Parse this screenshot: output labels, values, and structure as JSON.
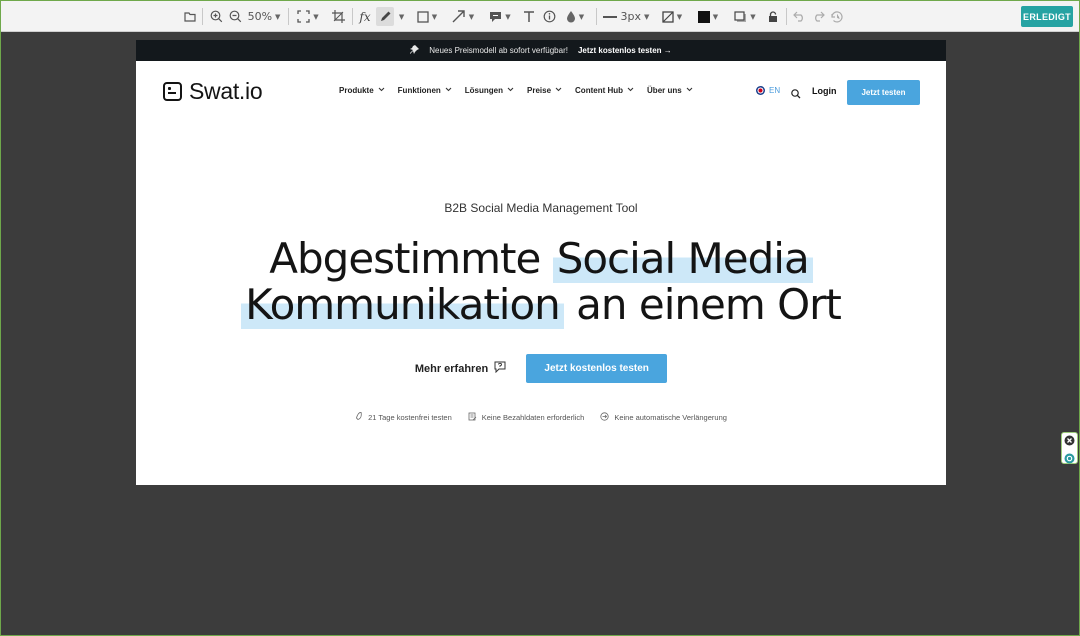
{
  "toolbar": {
    "zoom_value": "50%",
    "stroke_width": "3px",
    "fx_label": "fx",
    "done_label": "ERLEDIGT",
    "tools": [
      "folder-icon",
      "zoom-in-icon",
      "zoom-out-icon",
      "fit-icon",
      "crop-icon",
      "formula-icon",
      "pen-icon",
      "rectangle-icon",
      "arrow-icon",
      "comment-icon",
      "text-icon",
      "info-icon",
      "blur-icon",
      "line-width-icon",
      "fill-icon",
      "color-swatch",
      "shadow-icon",
      "lock-icon",
      "undo-icon",
      "redo-icon",
      "history-icon"
    ],
    "color_value": "#111111"
  },
  "page": {
    "banner": {
      "icon": "pin-icon",
      "text": "Neues Preismodell ab sofort verfügbar!",
      "link": "Jetzt kostenlos testen",
      "arrow": "→"
    },
    "logo_text": "Swat.io",
    "menu": [
      "Produkte",
      "Funktionen",
      "Lösungen",
      "Preise",
      "Content Hub",
      "Über uns"
    ],
    "lang": "EN",
    "login": "Login",
    "cta_top": "Jetzt testen",
    "subtitle": "B2B Social Media Management Tool",
    "headline": {
      "part1": "Abgestimmte",
      "highlight1": "Social Media",
      "highlight2": "Kommunikation",
      "part2": "an einem Ort"
    },
    "more_label": "Mehr erfahren",
    "cta_main": "Jetzt kostenlos testen",
    "features": [
      "21 Tage kostenfrei testen",
      "Keine Bezahldaten erforderlich",
      "Keine automatische Verlängerung"
    ]
  },
  "colors": {
    "accent": "#4aa5de",
    "done": "#26a3a3",
    "background": "#3c3c3c",
    "banner": "#13181c",
    "highlight": "#cde8f8"
  }
}
